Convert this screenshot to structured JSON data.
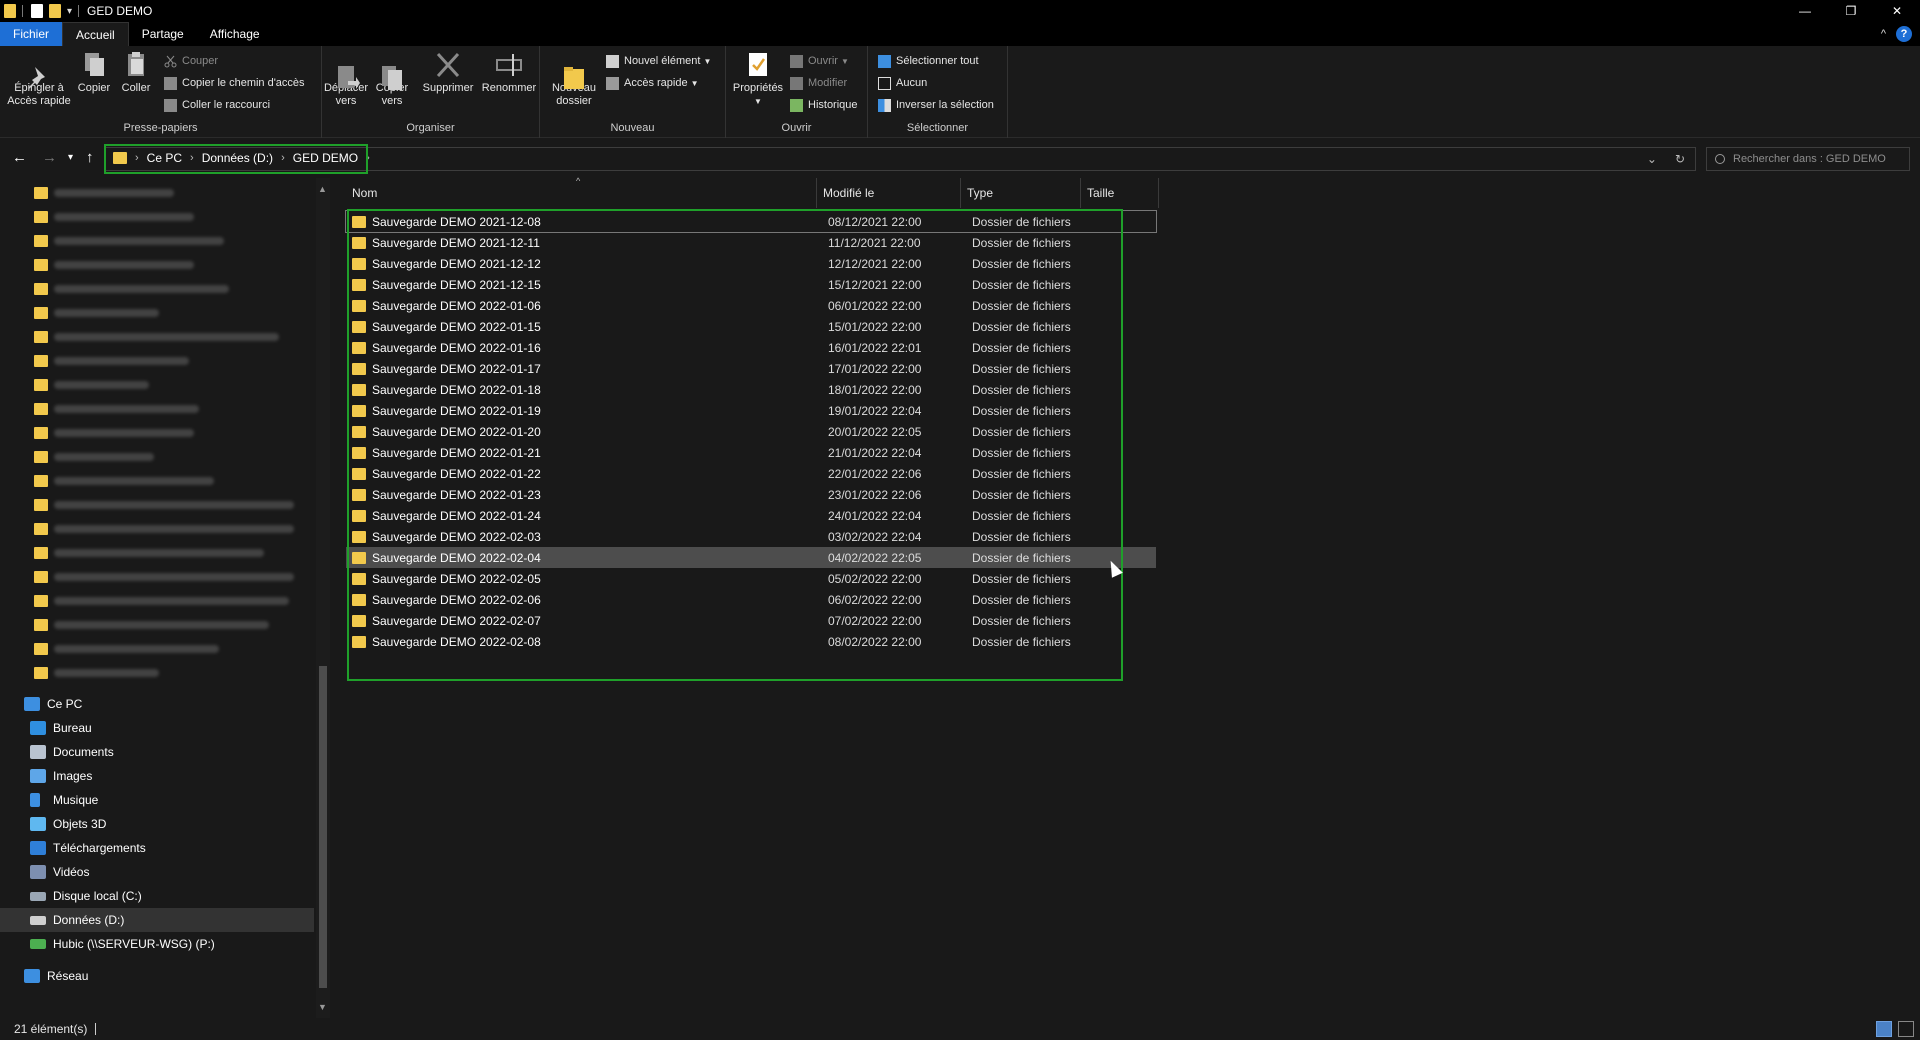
{
  "window": {
    "title": "GED DEMO",
    "controls": {
      "minimize": "—",
      "maximize": "❐",
      "close": "✕"
    },
    "quick_access_dropdown": "▾"
  },
  "ribbon_tabs": [
    {
      "label": "Fichier"
    },
    {
      "label": "Accueil"
    },
    {
      "label": "Partage"
    },
    {
      "label": "Affichage"
    }
  ],
  "ribbon": {
    "help": "?",
    "collapse": "^",
    "clipboard": {
      "pin_label": "Épingler à\nAccès rapide",
      "copy_label": "Copier",
      "paste_label": "Coller",
      "cut_label": "Couper",
      "copy_path_label": "Copier le chemin d'accès",
      "paste_shortcut_label": "Coller le raccourci",
      "group_label": "Presse-papiers"
    },
    "organize": {
      "move_label": "Déplacer\nvers",
      "copyto_label": "Copier\nvers",
      "delete_label": "Supprimer",
      "rename_label": "Renommer",
      "group_label": "Organiser"
    },
    "new": {
      "new_folder_label": "Nouveau\ndossier",
      "new_item_label": "Nouvel élément",
      "easy_access_label": "Accès rapide",
      "group_label": "Nouveau"
    },
    "open": {
      "properties_label": "Propriétés",
      "open_label": "Ouvrir",
      "edit_label": "Modifier",
      "history_label": "Historique",
      "group_label": "Ouvrir"
    },
    "select": {
      "select_all_label": "Sélectionner tout",
      "select_none_label": "Aucun",
      "invert_label": "Inverser la sélection",
      "group_label": "Sélectionner"
    }
  },
  "address_bar": {
    "breadcrumbs": [
      "Ce PC",
      "Données (D:)",
      "GED DEMO"
    ],
    "search_placeholder": "Rechercher dans : GED DEMO"
  },
  "sidebar": {
    "this_pc": "Ce PC",
    "items": [
      {
        "label": "Bureau",
        "icon": "desktop-icon",
        "color": "#2f8fe0"
      },
      {
        "label": "Documents",
        "icon": "documents-icon",
        "color": "#b9c3d0"
      },
      {
        "label": "Images",
        "icon": "pictures-icon",
        "color": "#5ea6e8"
      },
      {
        "label": "Musique",
        "icon": "music-icon",
        "color": "#3d8fe0"
      },
      {
        "label": "Objets 3D",
        "icon": "3d-objects-icon",
        "color": "#5fb8f0"
      },
      {
        "label": "Téléchargements",
        "icon": "downloads-icon",
        "color": "#2f7fd8"
      },
      {
        "label": "Vidéos",
        "icon": "videos-icon",
        "color": "#7d8fb0"
      },
      {
        "label": "Disque local (C:)",
        "icon": "drive-c-icon",
        "color": "#9aa7b5"
      },
      {
        "label": "Données (D:)",
        "icon": "drive-d-icon",
        "color": "#cfcfcf"
      },
      {
        "label": "Hubic (\\\\SERVEUR-WSG) (P:)",
        "icon": "network-drive-icon",
        "color": "#4caf50"
      }
    ],
    "network": "Réseau"
  },
  "columns": {
    "name": "Nom",
    "modified": "Modifié le",
    "type": "Type",
    "size": "Taille"
  },
  "files": [
    {
      "name": "Sauvegarde DEMO 2021-12-08",
      "modified": "08/12/2021 22:00",
      "type": "Dossier de fichiers"
    },
    {
      "name": "Sauvegarde DEMO 2021-12-11",
      "modified": "11/12/2021 22:00",
      "type": "Dossier de fichiers"
    },
    {
      "name": "Sauvegarde DEMO 2021-12-12",
      "modified": "12/12/2021 22:00",
      "type": "Dossier de fichiers"
    },
    {
      "name": "Sauvegarde DEMO 2021-12-15",
      "modified": "15/12/2021 22:00",
      "type": "Dossier de fichiers"
    },
    {
      "name": "Sauvegarde DEMO 2022-01-06",
      "modified": "06/01/2022 22:00",
      "type": "Dossier de fichiers"
    },
    {
      "name": "Sauvegarde DEMO 2022-01-15",
      "modified": "15/01/2022 22:00",
      "type": "Dossier de fichiers"
    },
    {
      "name": "Sauvegarde DEMO 2022-01-16",
      "modified": "16/01/2022 22:01",
      "type": "Dossier de fichiers"
    },
    {
      "name": "Sauvegarde DEMO 2022-01-17",
      "modified": "17/01/2022 22:00",
      "type": "Dossier de fichiers"
    },
    {
      "name": "Sauvegarde DEMO 2022-01-18",
      "modified": "18/01/2022 22:00",
      "type": "Dossier de fichiers"
    },
    {
      "name": "Sauvegarde DEMO 2022-01-19",
      "modified": "19/01/2022 22:04",
      "type": "Dossier de fichiers"
    },
    {
      "name": "Sauvegarde DEMO 2022-01-20",
      "modified": "20/01/2022 22:05",
      "type": "Dossier de fichiers"
    },
    {
      "name": "Sauvegarde DEMO 2022-01-21",
      "modified": "21/01/2022 22:04",
      "type": "Dossier de fichiers"
    },
    {
      "name": "Sauvegarde DEMO 2022-01-22",
      "modified": "22/01/2022 22:06",
      "type": "Dossier de fichiers"
    },
    {
      "name": "Sauvegarde DEMO 2022-01-23",
      "modified": "23/01/2022 22:06",
      "type": "Dossier de fichiers"
    },
    {
      "name": "Sauvegarde DEMO 2022-01-24",
      "modified": "24/01/2022 22:04",
      "type": "Dossier de fichiers"
    },
    {
      "name": "Sauvegarde DEMO 2022-02-03",
      "modified": "03/02/2022 22:04",
      "type": "Dossier de fichiers"
    },
    {
      "name": "Sauvegarde DEMO 2022-02-04",
      "modified": "04/02/2022 22:05",
      "type": "Dossier de fichiers"
    },
    {
      "name": "Sauvegarde DEMO 2022-02-05",
      "modified": "05/02/2022 22:00",
      "type": "Dossier de fichiers"
    },
    {
      "name": "Sauvegarde DEMO 2022-02-06",
      "modified": "06/02/2022 22:00",
      "type": "Dossier de fichiers"
    },
    {
      "name": "Sauvegarde DEMO 2022-02-07",
      "modified": "07/02/2022 22:00",
      "type": "Dossier de fichiers"
    },
    {
      "name": "Sauvegarde DEMO 2022-02-08",
      "modified": "08/02/2022 22:00",
      "type": "Dossier de fichiers"
    }
  ],
  "status": {
    "count": "21 élément(s)"
  },
  "colors": {
    "highlight_box": "#1fa02a",
    "folder": "#f2c94c",
    "file_tab": "#1e6fd6"
  }
}
